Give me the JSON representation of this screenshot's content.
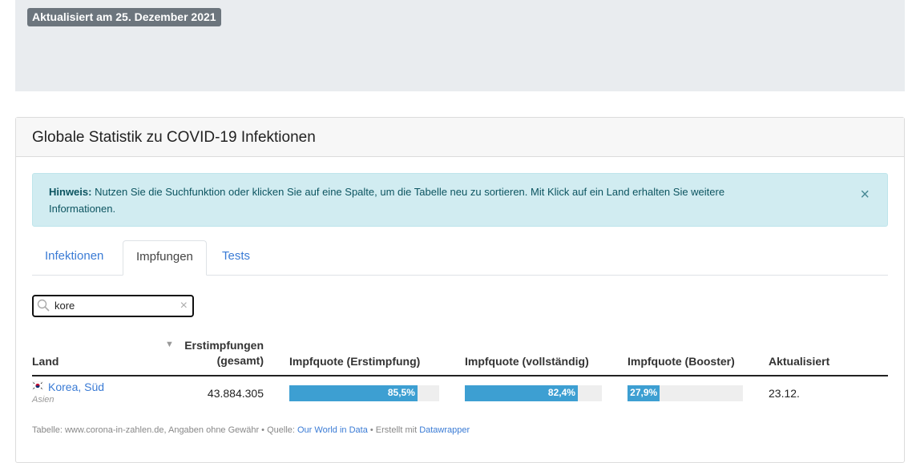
{
  "banner": {
    "updated": "Aktualisiert am 25. Dezember 2021"
  },
  "card": {
    "title": "Globale Statistik zu COVID-19 Infektionen"
  },
  "alert": {
    "label": "Hinweis:",
    "text": " Nutzen Sie die Suchfunktion oder klicken Sie auf eine Spalte, um die Tabelle neu zu sortieren. Mit Klick auf ein Land erhalten Sie weitere Informationen.",
    "close": "×"
  },
  "tabs": [
    {
      "label": "Infektionen"
    },
    {
      "label": "Impfungen",
      "active": true
    },
    {
      "label": "Tests"
    }
  ],
  "search": {
    "value": "kore",
    "clear": "×"
  },
  "table": {
    "headers": {
      "land": "Land",
      "first_line1": "Erstimpfungen",
      "first_line2": "(gesamt)",
      "quote_first": "Impfquote (Erstimpfung)",
      "quote_full": "Impfquote (vollständig)",
      "quote_booster": "Impfquote (Booster)",
      "updated": "Aktualisiert"
    },
    "sort_indicator": "▼",
    "rows": [
      {
        "country": "Korea, Süd",
        "continent": "Asien",
        "first_total": "43.884.305",
        "quote_first": {
          "label": "85,5%",
          "value": 85.5
        },
        "quote_full": {
          "label": "82,4%",
          "value": 82.4
        },
        "quote_booster": {
          "label": "27,9%",
          "value": 27.9
        },
        "updated": "23.12."
      }
    ]
  },
  "footer": {
    "prefix": "Tabelle: www.corona-in-zahlen.de, Angaben ohne Gewähr • Quelle: ",
    "source_link": "Our World in Data",
    "middle": " • Erstellt mit ",
    "tool_link": "Datawrapper"
  },
  "colors": {
    "bar": "#3d9fd2",
    "bar_track": "#eeeeee",
    "link": "#3a7bd5",
    "alert_bg": "#d1ecf1"
  }
}
